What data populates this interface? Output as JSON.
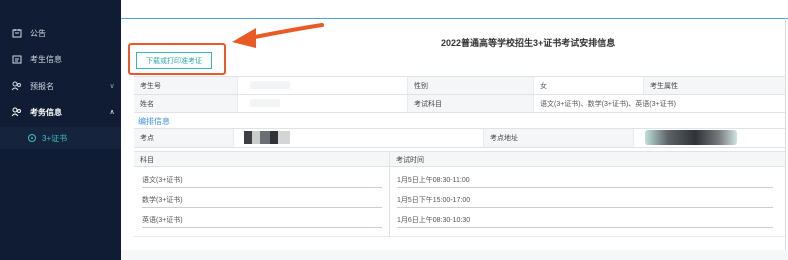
{
  "sidebar": {
    "items": [
      {
        "label": "公告",
        "icon": "notice-icon",
        "chevron": ""
      },
      {
        "label": "考生信息",
        "icon": "id-card-icon",
        "chevron": ""
      },
      {
        "label": "预报名",
        "icon": "users-icon",
        "chevron": "∨"
      },
      {
        "label": "考务信息",
        "icon": "users-icon",
        "chevron": "∧"
      }
    ],
    "sub_item": {
      "label": "3+证书",
      "icon": "radio-dot-icon"
    }
  },
  "header": {
    "title": "2022普通高等学校招生3+证书考试安排信息",
    "download_button": "下载或打印准考证"
  },
  "info_table": {
    "row1": {
      "label1": "考生号",
      "value1": "",
      "label2": "性别",
      "value2": "女",
      "label3": "考生属性",
      "value3": ""
    },
    "row2": {
      "label1": "姓名",
      "value1": "",
      "label2": "考试科目",
      "value2": "语文(3+证书)、数学(3+证书)、英语(3+证书)"
    }
  },
  "arrangement": {
    "section_title": "编排信息",
    "venue_label": "考点",
    "venue_address_label": "考点地址",
    "columns": {
      "subject": "科目",
      "time": "考试时间"
    },
    "rows": [
      {
        "subject": "语文(3+证书)",
        "time": "1月5日上午08:30-11:00"
      },
      {
        "subject": "数学(3+证书)",
        "time": "1月5日下午15:00-17:00"
      },
      {
        "subject": "英语(3+证书)",
        "time": "1月6日上午08:30-10:30"
      }
    ]
  },
  "colors": {
    "sidebar_bg": "#0f1c33",
    "accent_teal": "#34b7bd",
    "highlight_red": "#ea5a26",
    "link_blue": "#3a8fd8"
  }
}
